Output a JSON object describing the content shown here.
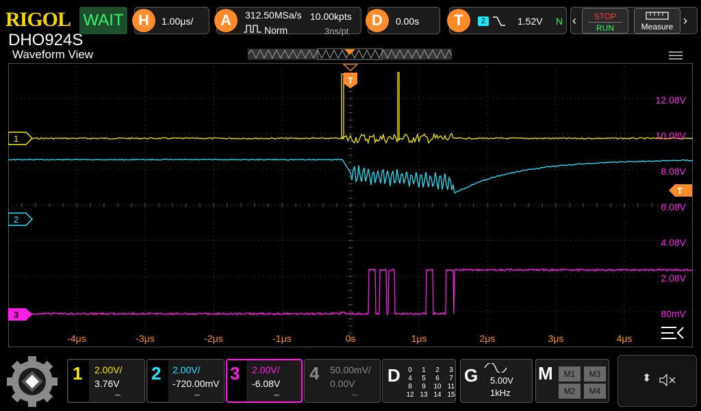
{
  "header": {
    "brand": "RIGOL",
    "model": "DHO924S",
    "run_state": "WAIT",
    "horizontal": {
      "key": "H",
      "scale": "1.00μs/"
    },
    "acquire": {
      "key": "A",
      "sample_rate": "312.50MSa/s",
      "memory": "10.00kpts",
      "mode": "Norm",
      "resolution": "3ns/pt"
    },
    "delay": {
      "key": "D",
      "offset": "0.00s"
    },
    "trigger": {
      "key": "T",
      "source": "2",
      "level": "1.52V",
      "sweep": "N"
    },
    "stop_label": "STOP",
    "run_label": "RUN",
    "measure_label": "Measure"
  },
  "view": {
    "title": "Waveform View",
    "menu_icon": "hamburger-icon"
  },
  "markers": {
    "ch1": "1",
    "ch2": "2",
    "ch3": "3",
    "trigger": "T"
  },
  "y_axis_labels": [
    "12.08V",
    "10.08V",
    "8.08V",
    "6.08V",
    "4.08V",
    "2.08V",
    "80mV"
  ],
  "x_axis_labels": [
    "-4μs",
    "-3μs",
    "-2μs",
    "-1μs",
    "0s",
    "1μs",
    "2μs",
    "3μs",
    "4μs"
  ],
  "channels": [
    {
      "num": "1",
      "scale": "2.00V/",
      "offset": "3.76V",
      "color": "#f7ec00"
    },
    {
      "num": "2",
      "scale": "2.00V/",
      "offset": "-720.00mV",
      "color": "#1de8ff"
    },
    {
      "num": "3",
      "scale": "2.00V/",
      "offset": "-6.08V",
      "color": "#ff1ee6"
    },
    {
      "num": "4",
      "scale": "50.00mV/",
      "offset": "0.00V",
      "color": "#8a8a8a"
    }
  ],
  "digital": {
    "key": "D",
    "grid": [
      "0",
      "1",
      "2",
      "3",
      "4",
      "5",
      "6",
      "7",
      "8",
      "9",
      "10",
      "11",
      "12",
      "13",
      "14",
      "15"
    ]
  },
  "generator": {
    "key": "G",
    "amplitude": "5.00V",
    "frequency": "1kHz"
  },
  "math": {
    "key": "M",
    "slots": [
      "M1",
      "M3",
      "M2",
      "M4"
    ]
  },
  "colors": {
    "accent": "#ff8b2b",
    "ch1": "#f7ec00",
    "ch2": "#1de8ff",
    "ch3": "#ff1ee6",
    "grid": "#5a5a5a"
  }
}
